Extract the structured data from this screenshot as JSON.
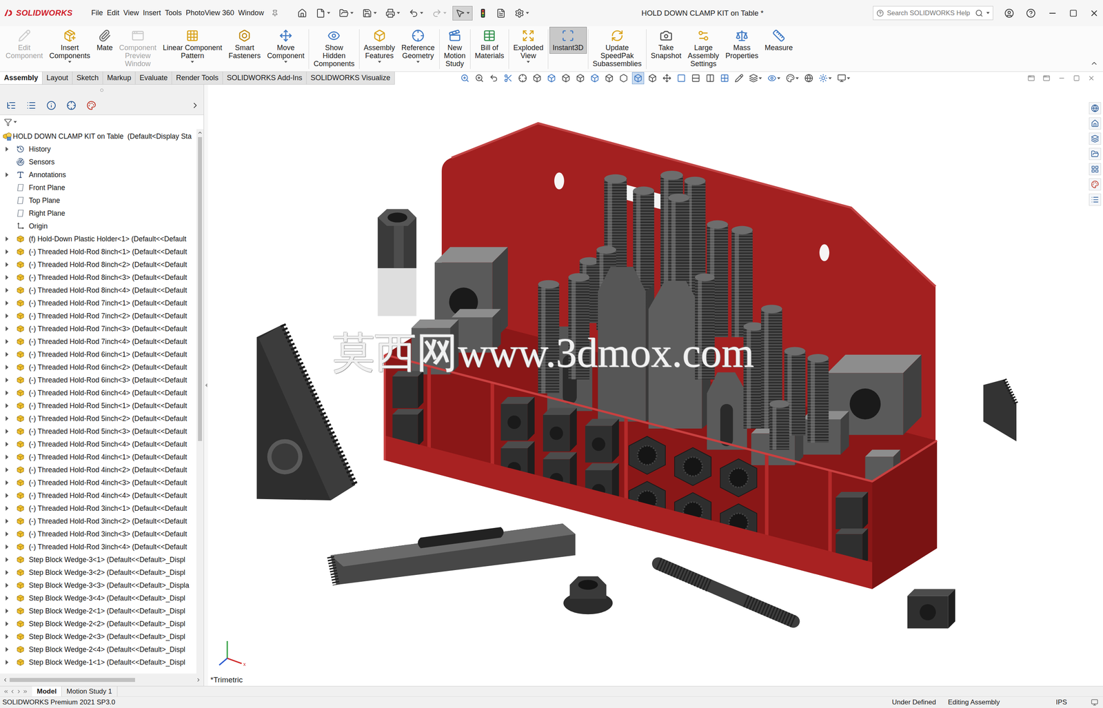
{
  "window": {
    "title": "HOLD DOWN CLAMP KIT on Table *"
  },
  "logo": {
    "text": "SOLIDWORKS"
  },
  "menu": [
    "File",
    "Edit",
    "View",
    "Insert",
    "Tools",
    "PhotoView 360",
    "Window"
  ],
  "quick_access": [
    {
      "selected": false,
      "dropdown": false,
      "disabled": false
    },
    {
      "selected": false,
      "dropdown": true,
      "disabled": false
    },
    {
      "selected": false,
      "dropdown": true,
      "disabled": false
    },
    {
      "selected": false,
      "dropdown": true,
      "disabled": false
    },
    {
      "selected": false,
      "dropdown": true,
      "disabled": false
    },
    {
      "selected": false,
      "dropdown": true,
      "disabled": false
    },
    {
      "selected": false,
      "dropdown": true,
      "disabled": true
    },
    {
      "selected": true,
      "dropdown": true,
      "disabled": false
    },
    {
      "selected": false,
      "dropdown": false,
      "disabled": false
    },
    {
      "selected": false,
      "dropdown": false,
      "disabled": false
    },
    {
      "selected": false,
      "dropdown": true,
      "disabled": false
    }
  ],
  "search": {
    "placeholder": "Search SOLIDWORKS Help"
  },
  "ribbon": [
    {
      "label": [
        "Edit",
        "Component"
      ],
      "disabled": true,
      "selected": false,
      "dropdown": false,
      "separator_after": false
    },
    {
      "label": [
        "Insert",
        "Components"
      ],
      "disabled": false,
      "selected": false,
      "dropdown": true,
      "separator_after": false
    },
    {
      "label": [
        "Mate"
      ],
      "disabled": false,
      "selected": false,
      "dropdown": false,
      "separator_after": false
    },
    {
      "label": [
        "Component",
        "Preview",
        "Window"
      ],
      "disabled": true,
      "selected": false,
      "dropdown": false,
      "separator_after": false
    },
    {
      "label": [
        "Linear Component",
        "Pattern"
      ],
      "disabled": false,
      "selected": false,
      "dropdown": true,
      "separator_after": false
    },
    {
      "label": [
        "Smart",
        "Fasteners"
      ],
      "disabled": false,
      "selected": false,
      "dropdown": false,
      "separator_after": false
    },
    {
      "label": [
        "Move",
        "Component"
      ],
      "disabled": false,
      "selected": false,
      "dropdown": true,
      "separator_after": true
    },
    {
      "label": [
        "Show",
        "Hidden",
        "Components"
      ],
      "disabled": false,
      "selected": false,
      "dropdown": false,
      "separator_after": true
    },
    {
      "label": [
        "Assembly",
        "Features"
      ],
      "disabled": false,
      "selected": false,
      "dropdown": true,
      "separator_after": false
    },
    {
      "label": [
        "Reference",
        "Geometry"
      ],
      "disabled": false,
      "selected": false,
      "dropdown": true,
      "separator_after": true
    },
    {
      "label": [
        "New",
        "Motion",
        "Study"
      ],
      "disabled": false,
      "selected": false,
      "dropdown": false,
      "separator_after": true
    },
    {
      "label": [
        "Bill of",
        "Materials"
      ],
      "disabled": false,
      "selected": false,
      "dropdown": false,
      "separator_after": true
    },
    {
      "label": [
        "Exploded",
        "View"
      ],
      "disabled": false,
      "selected": false,
      "dropdown": true,
      "separator_after": true
    },
    {
      "label": [
        "Instant3D"
      ],
      "disabled": false,
      "selected": true,
      "dropdown": false,
      "separator_after": true
    },
    {
      "label": [
        "Update",
        "SpeedPak",
        "Subassemblies"
      ],
      "disabled": false,
      "selected": false,
      "dropdown": false,
      "separator_after": true
    },
    {
      "label": [
        "Take",
        "Snapshot"
      ],
      "disabled": false,
      "selected": false,
      "dropdown": false,
      "separator_after": false
    },
    {
      "label": [
        "Large",
        "Assembly",
        "Settings"
      ],
      "disabled": false,
      "selected": false,
      "dropdown": false,
      "separator_after": false
    },
    {
      "label": [
        "Mass",
        "Properties"
      ],
      "disabled": false,
      "selected": false,
      "dropdown": false,
      "separator_after": false
    },
    {
      "label": [
        "Measure"
      ],
      "disabled": false,
      "selected": false,
      "dropdown": false,
      "separator_after": false
    }
  ],
  "command_tabs": [
    {
      "label": "Assembly",
      "selected": true
    },
    {
      "label": "Layout",
      "selected": false
    },
    {
      "label": "Sketch",
      "selected": false
    },
    {
      "label": "Markup",
      "selected": false
    },
    {
      "label": "Evaluate",
      "selected": false
    },
    {
      "label": "Render Tools",
      "selected": false
    },
    {
      "label": "SOLIDWORKS Add-Ins",
      "selected": false
    },
    {
      "label": "SOLIDWORKS Visualize",
      "selected": false
    }
  ],
  "view_toolbar": [
    {
      "selected": false,
      "dropdown": false
    },
    {
      "selected": false,
      "dropdown": false
    },
    {
      "selected": false,
      "dropdown": false
    },
    {
      "selected": false,
      "dropdown": false
    },
    {
      "selected": false,
      "dropdown": false
    },
    {
      "selected": false,
      "dropdown": false
    },
    {
      "selected": false,
      "dropdown": false
    },
    {
      "selected": false,
      "dropdown": false
    },
    {
      "selected": false,
      "dropdown": false
    },
    {
      "selected": false,
      "dropdown": false
    },
    {
      "selected": false,
      "dropdown": false
    },
    {
      "selected": false,
      "dropdown": false
    },
    {
      "selected": true,
      "dropdown": false
    },
    {
      "selected": false,
      "dropdown": false
    },
    {
      "selected": false,
      "dropdown": false
    },
    {
      "selected": false,
      "dropdown": false
    },
    {
      "selected": false,
      "dropdown": false
    },
    {
      "selected": false,
      "dropdown": false
    },
    {
      "selected": false,
      "dropdown": false
    },
    {
      "selected": false,
      "dropdown": false
    },
    {
      "selected": false,
      "dropdown": true
    },
    {
      "selected": false,
      "dropdown": true
    },
    {
      "selected": false,
      "dropdown": true
    },
    {
      "selected": false,
      "dropdown": false
    },
    {
      "selected": false,
      "dropdown": true
    },
    {
      "selected": false,
      "dropdown": true
    }
  ],
  "tree": {
    "root": "HOLD DOWN CLAMP KIT on Table  (Default<Display Sta",
    "items": [
      {
        "label": "History",
        "kind": "history",
        "expandable": true
      },
      {
        "label": "Sensors",
        "kind": "sensors",
        "expandable": false
      },
      {
        "label": "Annotations",
        "kind": "annotations",
        "expandable": true
      },
      {
        "label": "Front Plane",
        "kind": "plane",
        "expandable": false
      },
      {
        "label": "Top Plane",
        "kind": "plane",
        "expandable": false
      },
      {
        "label": "Right Plane",
        "kind": "plane",
        "expandable": false
      },
      {
        "label": "Origin",
        "kind": "origin",
        "expandable": false
      },
      {
        "label": "(f) Hold-Down Plastic Holder<1> (Default<<Default",
        "kind": "component",
        "expandable": true
      },
      {
        "label": "(-) Threaded Hold-Rod 8inch<1> (Default<<Default",
        "kind": "component",
        "expandable": true
      },
      {
        "label": "(-) Threaded Hold-Rod 8inch<2> (Default<<Default",
        "kind": "component",
        "expandable": true
      },
      {
        "label": "(-) Threaded Hold-Rod 8inch<3> (Default<<Default",
        "kind": "component",
        "expandable": true
      },
      {
        "label": "(-) Threaded Hold-Rod 8inch<4> (Default<<Default",
        "kind": "component",
        "expandable": true
      },
      {
        "label": "(-) Threaded Hold-Rod 7inch<1> (Default<<Default",
        "kind": "component",
        "expandable": true
      },
      {
        "label": "(-) Threaded Hold-Rod 7inch<2> (Default<<Default",
        "kind": "component",
        "expandable": true
      },
      {
        "label": "(-) Threaded Hold-Rod 7inch<3> (Default<<Default",
        "kind": "component",
        "expandable": true
      },
      {
        "label": "(-) Threaded Hold-Rod 7inch<4> (Default<<Default",
        "kind": "component",
        "expandable": true
      },
      {
        "label": "(-) Threaded Hold-Rod 6inch<1> (Default<<Default",
        "kind": "component",
        "expandable": true
      },
      {
        "label": "(-) Threaded Hold-Rod 6inch<2> (Default<<Default",
        "kind": "component",
        "expandable": true
      },
      {
        "label": "(-) Threaded Hold-Rod 6inch<3> (Default<<Default",
        "kind": "component",
        "expandable": true
      },
      {
        "label": "(-) Threaded Hold-Rod 6inch<4> (Default<<Default",
        "kind": "component",
        "expandable": true
      },
      {
        "label": "(-) Threaded Hold-Rod 5inch<1> (Default<<Default",
        "kind": "component",
        "expandable": true
      },
      {
        "label": "(-) Threaded Hold-Rod 5inch<2> (Default<<Default",
        "kind": "component",
        "expandable": true
      },
      {
        "label": "(-) Threaded Hold-Rod 5inch<3> (Default<<Default",
        "kind": "component",
        "expandable": true
      },
      {
        "label": "(-) Threaded Hold-Rod 5inch<4> (Default<<Default",
        "kind": "component",
        "expandable": true
      },
      {
        "label": "(-) Threaded Hold-Rod 4inch<1> (Default<<Default",
        "kind": "component",
        "expandable": true
      },
      {
        "label": "(-) Threaded Hold-Rod 4inch<2> (Default<<Default",
        "kind": "component",
        "expandable": true
      },
      {
        "label": "(-) Threaded Hold-Rod 4inch<3> (Default<<Default",
        "kind": "component",
        "expandable": true
      },
      {
        "label": "(-) Threaded Hold-Rod 4inch<4> (Default<<Default",
        "kind": "component",
        "expandable": true
      },
      {
        "label": "(-) Threaded Hold-Rod 3inch<1> (Default<<Default",
        "kind": "component",
        "expandable": true
      },
      {
        "label": "(-) Threaded Hold-Rod 3inch<2> (Default<<Default",
        "kind": "component",
        "expandable": true
      },
      {
        "label": "(-) Threaded Hold-Rod 3inch<3> (Default<<Default",
        "kind": "component",
        "expandable": true
      },
      {
        "label": "(-) Threaded Hold-Rod 3inch<4> (Default<<Default",
        "kind": "component",
        "expandable": true
      },
      {
        "label": "Step Block Wedge-3<1> (Default<<Default>_Displ",
        "kind": "component",
        "expandable": true
      },
      {
        "label": "Step Block Wedge-3<2> (Default<<Default>_Displ",
        "kind": "component",
        "expandable": true
      },
      {
        "label": "Step Block Wedge-3<3> (Default<<Default>_Displa",
        "kind": "component",
        "expandable": true
      },
      {
        "label": "Step Block Wedge-3<4> (Default<<Default>_Displ",
        "kind": "component",
        "expandable": true
      },
      {
        "label": "Step Block Wedge-2<1> (Default<<Default>_Displ",
        "kind": "component",
        "expandable": true
      },
      {
        "label": "Step Block Wedge-2<2> (Default<<Default>_Displ",
        "kind": "component",
        "expandable": true
      },
      {
        "label": "Step Block Wedge-2<3> (Default<<Default>_Displ",
        "kind": "component",
        "expandable": true
      },
      {
        "label": "Step Block Wedge-2<4> (Default<<Default>_Displ",
        "kind": "component",
        "expandable": true
      },
      {
        "label": "Step Block Wedge-1<1> (Default<<Default>_Displ",
        "kind": "component",
        "expandable": true
      }
    ]
  },
  "tree_scrollbar": {
    "level": 0.56
  },
  "tree_hscrollbar": {
    "level": 0.68
  },
  "viewport": {
    "view_name": "*Trimetric",
    "watermark": "莫西网www.3dmox.com",
    "triad_label": "x"
  },
  "bottom_tabs": [
    {
      "label": "Model",
      "selected": true
    },
    {
      "label": "Motion Study 1",
      "selected": false
    }
  ],
  "status_bar": {
    "product": "SOLIDWORKS Premium 2021 SP3.0",
    "items": [
      "Under Defined",
      "Editing Assembly",
      "IPS"
    ]
  }
}
